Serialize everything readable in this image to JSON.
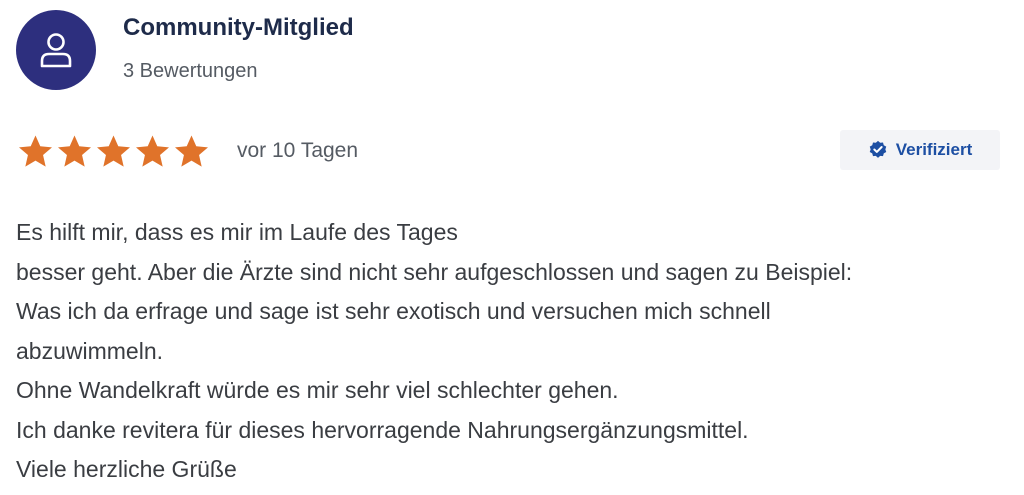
{
  "author": {
    "name": "Community-Mitglied",
    "review_count": "3 Bewertungen",
    "avatar_icon": "user-icon",
    "avatar_color": "#2d2f7e"
  },
  "review": {
    "rating": 5,
    "rating_max": 5,
    "star_color": "#e0732a",
    "date": "vor 10 Tagen",
    "verified_label": "Verifiziert",
    "verified_icon": "verified-check-icon",
    "verified_color": "#1d4fa3",
    "lines": [
      "Es hilft mir, dass es mir im Laufe des Tages",
      "besser geht. Aber die Ärzte sind nicht sehr aufgeschlossen und sagen zu Beispiel:",
      "Was ich da erfrage und sage ist sehr exotisch und versuchen mich schnell",
      "abzuwimmeln.",
      "Ohne Wandelkraft würde es mir sehr viel schlechter gehen.",
      "Ich danke revitera für dieses hervorragende Nahrungsergänzungsmittel.",
      "Viele herzliche Grüße"
    ]
  }
}
